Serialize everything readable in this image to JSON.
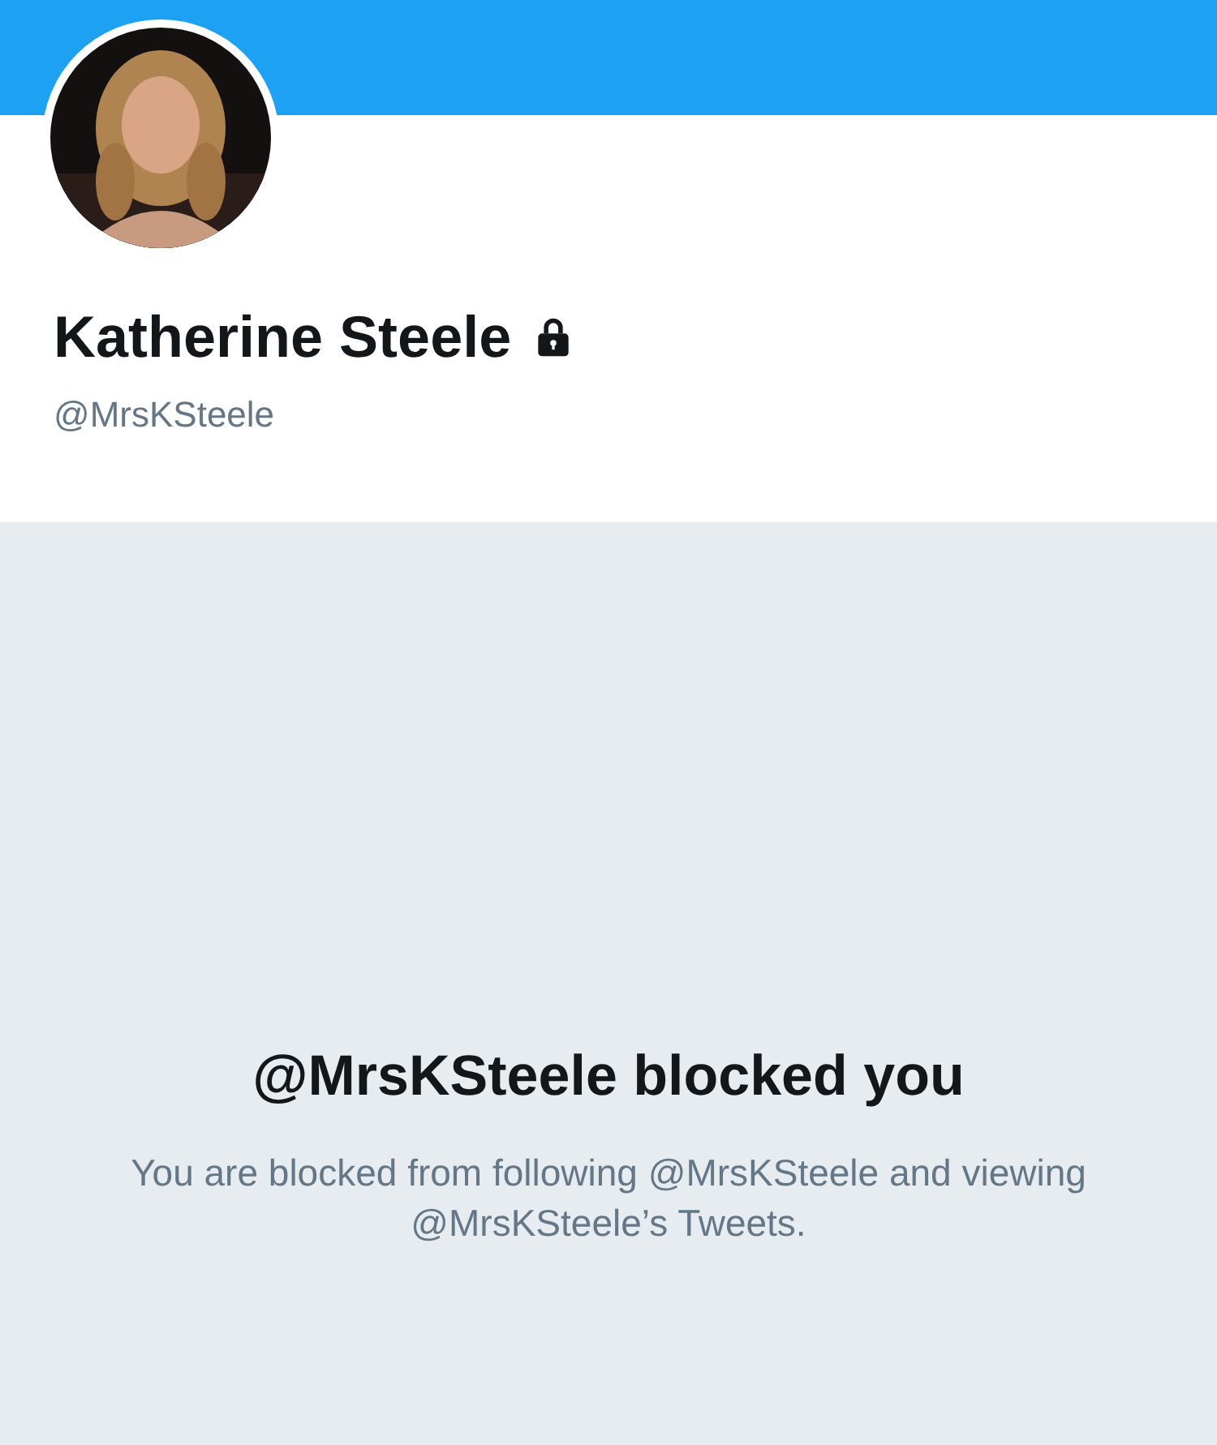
{
  "profile": {
    "name": "Katherine Steele",
    "locked": true,
    "handle": "@MrsKSteele"
  },
  "blocked_notice": {
    "title": "@MrsKSteele blocked you",
    "message": "You are blocked from following @MrsKSteele and viewing @MrsKSteele’s Tweets."
  }
}
